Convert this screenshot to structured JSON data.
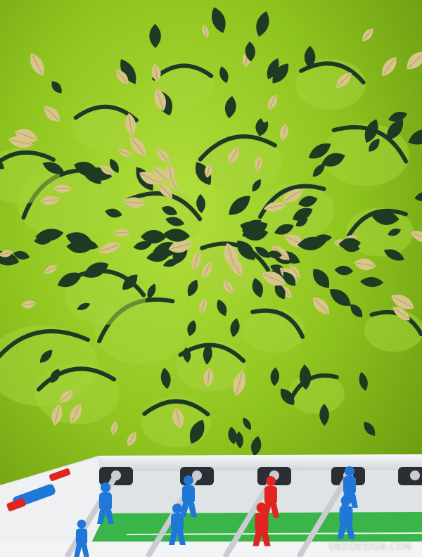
{
  "photo": {
    "subject": "felt-leaf-wall-with-foosball-table",
    "colors": {
      "wall": "#8fc41f",
      "wall_shadow": "#6f9f12",
      "leaf_dark": "#1f3a23",
      "leaf_tan": "#d8c58a",
      "leaf_flap": "#a6d33a",
      "table_body": "#e9ecef",
      "field": "#39b54a",
      "team_blue": "#1f78d8",
      "team_red": "#e02420",
      "rod": "#c9ccd1"
    }
  },
  "watermark": {
    "text": "UKKDESIGN.COM"
  }
}
